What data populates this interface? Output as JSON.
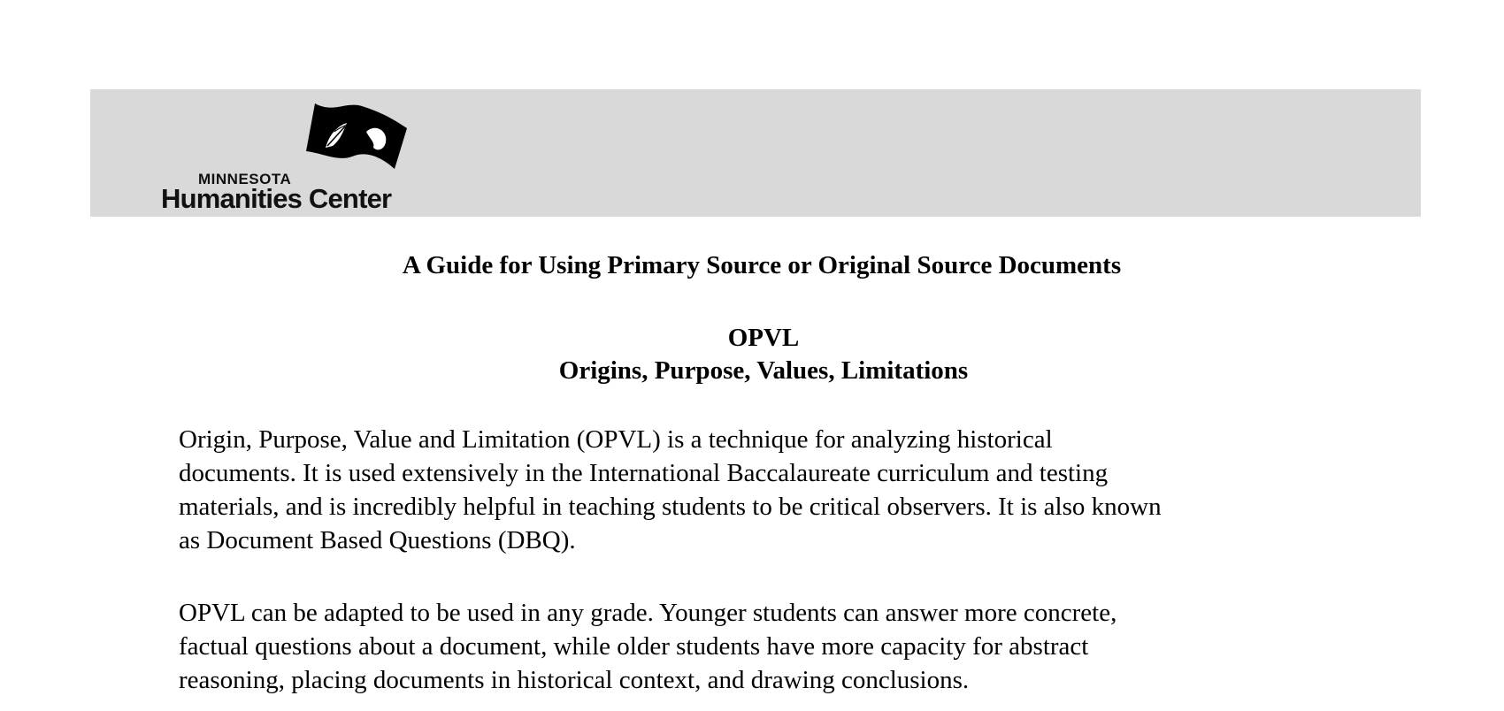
{
  "header": {
    "band_color": "#d9d9d9",
    "logo": {
      "line1": "MINNESOTA",
      "line2": "Humanities Center",
      "flag_icon": "flag-icon"
    }
  },
  "document": {
    "title": "A Guide for Using Primary Source or Original Source Documents",
    "acronym": "OPVL",
    "acronym_expansion": "Origins, Purpose, Values, Limitations",
    "paragraphs": [
      {
        "lines": [
          "Origin, Purpose, Value and Limitation (OPVL) is a technique for analyzing historical",
          "documents.  It is used extensively in the International Baccalaureate curriculum and testing",
          "materials, and is incredibly helpful in teaching students to be critical observers.  It is also known",
          "as Document Based Questions (DBQ)."
        ]
      },
      {
        "lines": [
          "OPVL can be adapted to be used in any grade.  Younger students can answer more concrete,",
          "factual questions about a document, while older students have more capacity for abstract",
          "reasoning, placing documents in historical context, and drawing conclusions."
        ]
      }
    ]
  }
}
